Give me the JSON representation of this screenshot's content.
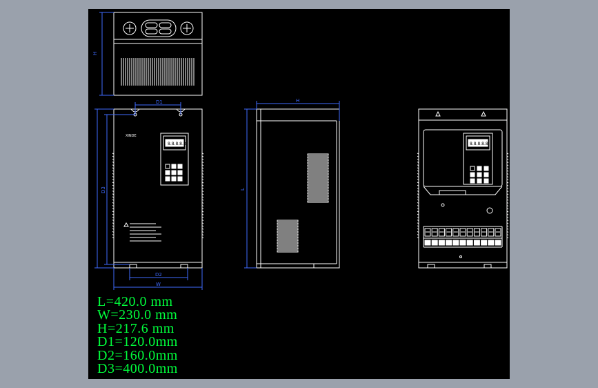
{
  "colors": {
    "background": "#9aa1ac",
    "drawing_area": "#000000",
    "outline": "#ffffff",
    "dimension_lines": "#3f6bff",
    "dimension_text": "#00ff3c"
  },
  "drawing": {
    "dimension_labels": {
      "top_view_height": "H",
      "front_width_top": "D1",
      "front_height": "D3",
      "front_bottom_holes": "D2",
      "front_width": "W",
      "side_depth": "H",
      "side_length": "L"
    },
    "front_panel_text": {
      "brand": "XINDE",
      "display": "8.8.8.8.8"
    },
    "dimension_list": [
      "L=420.0 mm",
      "W=230.0 mm",
      "H=217.6 mm",
      "D1=120.0mm",
      "D2=160.0mm",
      "D3=400.0mm"
    ]
  }
}
